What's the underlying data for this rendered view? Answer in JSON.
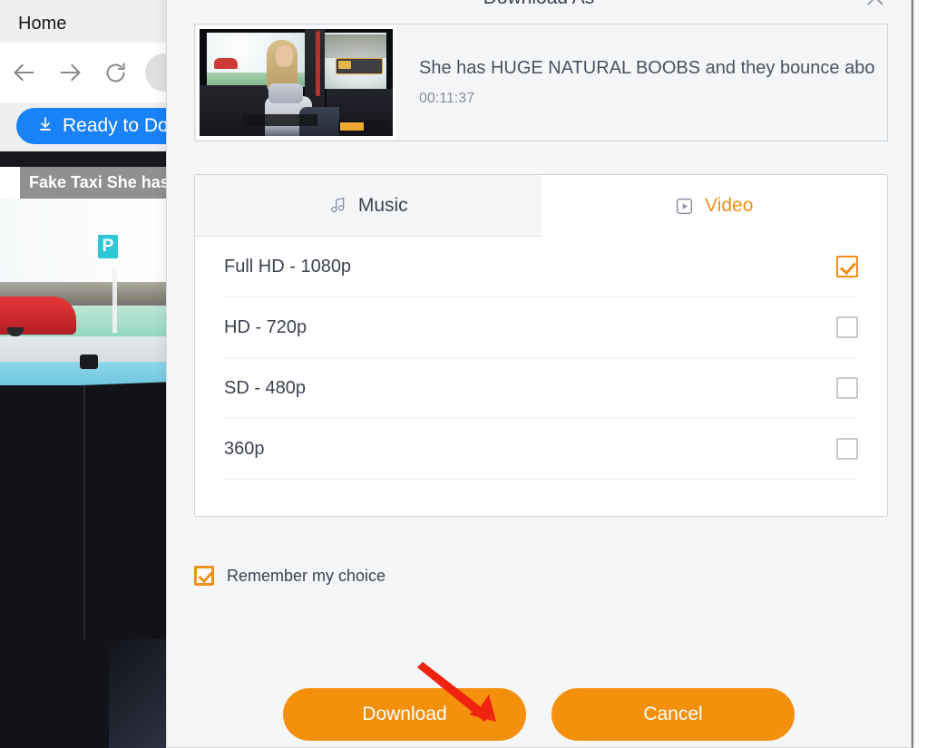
{
  "browser": {
    "tab_title": "Home",
    "nav": {
      "back_icon": "arrow-left-icon",
      "forward_icon": "arrow-right-icon",
      "reload_icon": "reload-icon"
    },
    "address_bar_value": "",
    "bookmark_button": {
      "label": "Ready to Do",
      "icon": "download-arrow-icon",
      "color": "#1a82f7"
    },
    "page": {
      "video_overlay_title": "Fake Taxi She has"
    }
  },
  "modal": {
    "title": "Download As",
    "close_icon": "close-icon",
    "video": {
      "name": "She has HUGE NATURAL BOOBS and they bounce abo",
      "duration": "00:11:37",
      "thumbnail_alt": "taxi-back-seat-thumbnail"
    },
    "tabs": [
      {
        "label": "Music",
        "icon": "music-note-icon",
        "active": false
      },
      {
        "label": "Video",
        "icon": "video-play-icon",
        "active": true
      }
    ],
    "qualities": [
      {
        "label": "Full HD - 1080p",
        "checked": true
      },
      {
        "label": "HD - 720p",
        "checked": false
      },
      {
        "label": "SD - 480p",
        "checked": false
      },
      {
        "label": "360p",
        "checked": false
      }
    ],
    "remember": {
      "label": "Remember my choice",
      "checked": true
    },
    "buttons": {
      "primary": "Download",
      "secondary": "Cancel"
    },
    "colors": {
      "accent": "#ef9019",
      "button": "#f4900c",
      "annotation_arrow": "#f02311"
    }
  },
  "annotation": {
    "arrow_icon": "red-arrow-icon",
    "points_to": "Download"
  }
}
